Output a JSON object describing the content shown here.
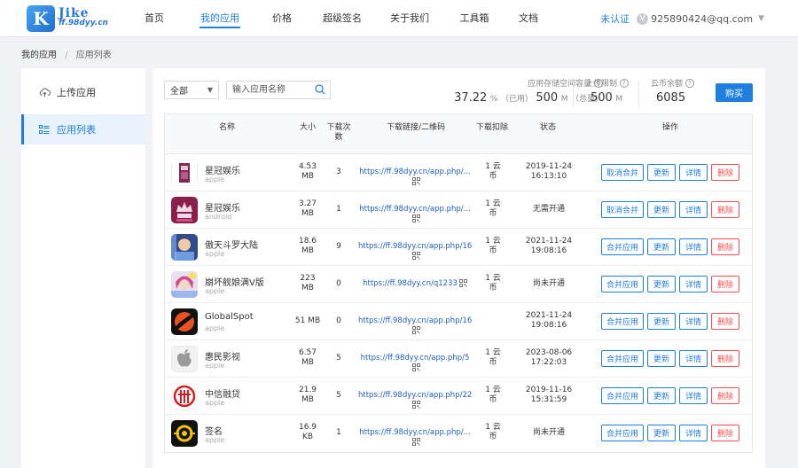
{
  "logo": {
    "title": "Jike",
    "subtitle": "ff.98dyy.cn"
  },
  "nav": [
    {
      "label": "首页",
      "active": false
    },
    {
      "label": "我的应用",
      "active": true
    },
    {
      "label": "价格",
      "active": false
    },
    {
      "label": "超级签名",
      "active": false
    },
    {
      "label": "关于我们",
      "active": false
    },
    {
      "label": "工具箱",
      "active": false
    },
    {
      "label": "文档",
      "active": false
    }
  ],
  "user": {
    "verify_status": "未认证",
    "badge": "V",
    "email": "925890424@qq.com"
  },
  "breadcrumb": {
    "root": "我的应用",
    "separator": "/",
    "current": "应用列表"
  },
  "sidebar": {
    "items": [
      {
        "label": "上传应用",
        "icon": "cloud-upload-icon",
        "active": false
      },
      {
        "label": "应用列表",
        "icon": "list-icon",
        "active": true
      }
    ]
  },
  "toolbar": {
    "filter_value": "全部",
    "search_placeholder": "输入应用名称"
  },
  "stats": {
    "storage": {
      "label": "应用存储空间容量",
      "used_pct": "37.22",
      "pct_unit": "%",
      "used_label": "（已用）",
      "total": "500",
      "total_unit": "M",
      "total_label": "（总量）"
    },
    "upload_limit": {
      "label": "上传限制",
      "value": "500",
      "unit": "M"
    },
    "coins": {
      "label": "云币余额",
      "value": "6085"
    },
    "help_glyph": "?",
    "buy_label": "购买"
  },
  "table": {
    "headers": {
      "name": "名称",
      "size": "大小",
      "downloads_1": "下载次",
      "downloads_2": "数",
      "link": "下载链接/二维码",
      "deduction": "下载扣除",
      "status": "状态",
      "ops": "操作"
    },
    "rows": [
      {
        "name": "星冠娱乐",
        "platform": "apple",
        "icon": "xingguan-apple-icon",
        "size_1": "4.53",
        "size_2": "MB",
        "downloads": "3",
        "link": "https://ff.98dyy.cn/app.php/...",
        "deduction_1": "1 云",
        "deduction_2": "币",
        "status_1": "2019-11-24",
        "status_2": "16:13:10",
        "merge_label": "取消合并"
      },
      {
        "name": "星冠娱乐",
        "platform": "android",
        "icon": "xingguan-android-icon",
        "size_1": "3.27",
        "size_2": "MB",
        "downloads": "1",
        "link": "https://ff.98dyy.cn/app.php/...",
        "deduction_1": "1 云",
        "deduction_2": "币",
        "status_1": "无需开通",
        "status_2": "",
        "merge_label": "取消合并"
      },
      {
        "name": "傲天斗罗大陆",
        "platform": "apple",
        "icon": "aotian-game-icon",
        "size_1": "18.6",
        "size_2": "MB",
        "downloads": "9",
        "link": "https://ff.98dyy.cn/app.php/16",
        "deduction_1": "1 云",
        "deduction_2": "币",
        "status_1": "2021-11-24",
        "status_2": "19:08:16",
        "merge_label": "合并应用"
      },
      {
        "name": "崩坏舰娘满V版",
        "platform": "apple",
        "icon": "benghuai-game-icon",
        "size_1": "223",
        "size_2": "MB",
        "downloads": "0",
        "link": "https://ff.98dyy.cn/q1233",
        "deduction_1": "1 云",
        "deduction_2": "币",
        "status_1": "尚未开通",
        "status_2": "",
        "merge_label": "合并应用"
      },
      {
        "name": "GlobalSpot",
        "platform": "apple",
        "icon": "globalspot-icon",
        "size_1": "51 MB",
        "size_2": "",
        "downloads": "0",
        "link": "https://ff.98dyy.cn/app.php/16",
        "deduction_1": "",
        "deduction_2": "",
        "status_1": "2021-11-24",
        "status_2": "19:08:16",
        "merge_label": "合并应用"
      },
      {
        "name": "惠民影视",
        "platform": "apple",
        "icon": "apple-logo-icon",
        "size_1": "6.57",
        "size_2": "MB",
        "downloads": "5",
        "link": "https://ff.98dyy.cn/app.php/5",
        "deduction_1": "1 云",
        "deduction_2": "币",
        "status_1": "2023-08-06",
        "status_2": "17:22:03",
        "merge_label": "合并应用"
      },
      {
        "name": "中信融贷",
        "platform": "apple",
        "icon": "citic-logo-icon",
        "size_1": "21.9",
        "size_2": "MB",
        "downloads": "5",
        "link": "https://ff.98dyy.cn/app.php/22",
        "deduction_1": "1 云",
        "deduction_2": "币",
        "status_1": "2019-11-16",
        "status_2": "15:31:59",
        "merge_label": "合并应用"
      },
      {
        "name": "签名",
        "platform": "apple",
        "icon": "sign-app-icon",
        "size_1": "16.9",
        "size_2": "KB",
        "downloads": "1",
        "link": "https://ff.98dyy.cn/app.php/...",
        "deduction_1": "1 云",
        "deduction_2": "币",
        "status_1": "尚未开通",
        "status_2": "",
        "merge_label": "合并应用"
      }
    ],
    "update_label": "更新",
    "detail_label": "详情",
    "delete_label": "删除"
  },
  "colors": {
    "accent": "#1f7fe0",
    "danger": "#f05050",
    "background": "#f0f2f5"
  }
}
